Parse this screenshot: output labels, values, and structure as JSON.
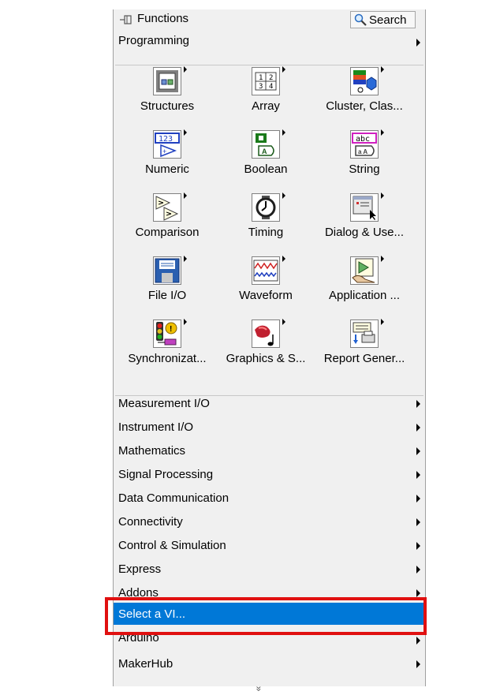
{
  "palette": {
    "title": "Functions",
    "search_label": "Search",
    "header_row": "Programming",
    "icons": [
      {
        "label": "Structures",
        "icon": "structures-icon"
      },
      {
        "label": "Array",
        "icon": "array-icon"
      },
      {
        "label": "Cluster, Clas...",
        "icon": "cluster-icon"
      },
      {
        "label": "Numeric",
        "icon": "numeric-icon"
      },
      {
        "label": "Boolean",
        "icon": "boolean-icon"
      },
      {
        "label": "String",
        "icon": "string-icon"
      },
      {
        "label": "Comparison",
        "icon": "comparison-icon"
      },
      {
        "label": "Timing",
        "icon": "timing-icon"
      },
      {
        "label": "Dialog & Use...",
        "icon": "dialog-icon"
      },
      {
        "label": "File I/O",
        "icon": "file-io-icon"
      },
      {
        "label": "Waveform",
        "icon": "waveform-icon"
      },
      {
        "label": "Application ...",
        "icon": "application-icon"
      },
      {
        "label": "Synchronizat...",
        "icon": "synchronization-icon"
      },
      {
        "label": "Graphics & S...",
        "icon": "graphics-sound-icon"
      },
      {
        "label": "Report Gener...",
        "icon": "report-generation-icon"
      }
    ],
    "icon_glyphs": {
      "array": [
        "1",
        "2",
        "3",
        "4"
      ],
      "numeric": "123",
      "string": "abc",
      "boolean": "A",
      "comparison": "",
      "string_sub": "a A"
    },
    "rows": [
      "Measurement I/O",
      "Instrument I/O",
      "Mathematics",
      "Signal Processing",
      "Data Communication",
      "Connectivity",
      "Control & Simulation",
      "Express",
      "Addons",
      "Select a VI...",
      "Arduino",
      "MakerHub"
    ],
    "selected_row": "Select a VI...",
    "more_glyph": "»"
  },
  "colors": {
    "selection": "#0078d7",
    "highlight_border": "#e01010",
    "panel_bg": "#f0f0f0"
  }
}
